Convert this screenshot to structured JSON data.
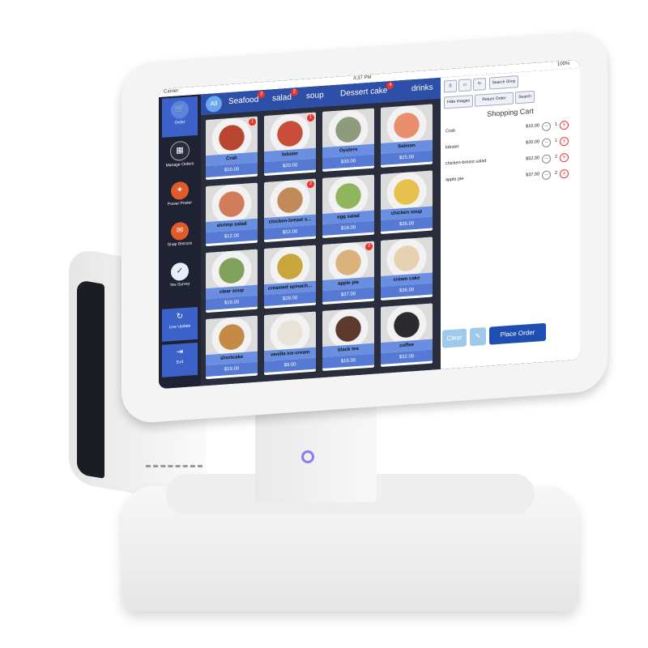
{
  "status": {
    "carrier": "Carrier",
    "time": "4:37 PM",
    "battery": "100%"
  },
  "sidebar": {
    "items": [
      {
        "label": "Order",
        "icon": "cart-icon"
      },
      {
        "label": "Manage Orders",
        "icon": "grid-icon"
      },
      {
        "label": "Power Poster",
        "icon": "poster-icon"
      },
      {
        "label": "Snap Discuss",
        "icon": "chat-icon"
      },
      {
        "label": "Yes Survey",
        "icon": "survey-icon"
      },
      {
        "label": "Live Update",
        "icon": "update-icon"
      },
      {
        "label": "Exit",
        "icon": "exit-icon"
      }
    ]
  },
  "nav": {
    "all_label": "All",
    "tabs": [
      {
        "label": "Seafood",
        "badge": "2"
      },
      {
        "label": "salad",
        "badge": "2"
      },
      {
        "label": "soup",
        "badge": ""
      },
      {
        "label": "Dessert cake",
        "badge": "4"
      },
      {
        "label": "drinks",
        "badge": ""
      }
    ]
  },
  "menu": [
    {
      "name": "Crab",
      "price": "$10.00",
      "color": "#b8452f",
      "badge": "1"
    },
    {
      "name": "lobster",
      "price": "$20.00",
      "color": "#c94d3a",
      "badge": "1"
    },
    {
      "name": "Oysters",
      "price": "$30.00",
      "color": "#8f9c7c",
      "badge": ""
    },
    {
      "name": "Salmon",
      "price": "$25.00",
      "color": "#e88d6e",
      "badge": ""
    },
    {
      "name": "shrimp salad",
      "price": "$12.00",
      "color": "#d27b5a",
      "badge": ""
    },
    {
      "name": "chicken-breast s...",
      "price": "$52.00",
      "color": "#c18a58",
      "badge": "2"
    },
    {
      "name": "egg salad",
      "price": "$18.00",
      "color": "#8fb65c",
      "badge": ""
    },
    {
      "name": "chicken soup",
      "price": "$35.00",
      "color": "#e8c04d",
      "badge": ""
    },
    {
      "name": "clear soup",
      "price": "$19.00",
      "color": "#7fa15b",
      "badge": ""
    },
    {
      "name": "creamed spinach...",
      "price": "$28.00",
      "color": "#c9a63d",
      "badge": ""
    },
    {
      "name": "apple pie",
      "price": "$37.00",
      "color": "#d9b27c",
      "badge": "2"
    },
    {
      "name": "cream cake",
      "price": "$36.00",
      "color": "#e6d2b0",
      "badge": ""
    },
    {
      "name": "shortcake",
      "price": "$19.00",
      "color": "#c58a45",
      "badge": ""
    },
    {
      "name": "vanilla ice-cream",
      "price": "$9.00",
      "color": "#e9e2d6",
      "badge": ""
    },
    {
      "name": "black tea",
      "price": "$16.00",
      "color": "#5b3a2c",
      "badge": ""
    },
    {
      "name": "coffee",
      "price": "$32.00",
      "color": "#2b2a2e",
      "badge": ""
    }
  ],
  "panel": {
    "buttons": [
      "Search Shop",
      "Hide Images",
      "Return Order",
      "Search"
    ],
    "cart_title": "Shopping Cart",
    "cart": [
      {
        "name": "Crab",
        "price": "$10.00",
        "qty": "1"
      },
      {
        "name": "lobster",
        "price": "$20.00",
        "qty": "1"
      },
      {
        "name": "chicken-breast salad",
        "price": "$52.00",
        "qty": "2"
      },
      {
        "name": "apple pie",
        "price": "$37.00",
        "qty": "2"
      }
    ],
    "clear_label": "Clear",
    "place_label": "Place Order"
  },
  "colors": {
    "accent": "#2d4fa8",
    "place_order": "#1e4fb0",
    "clear": "#9ec9ea"
  }
}
